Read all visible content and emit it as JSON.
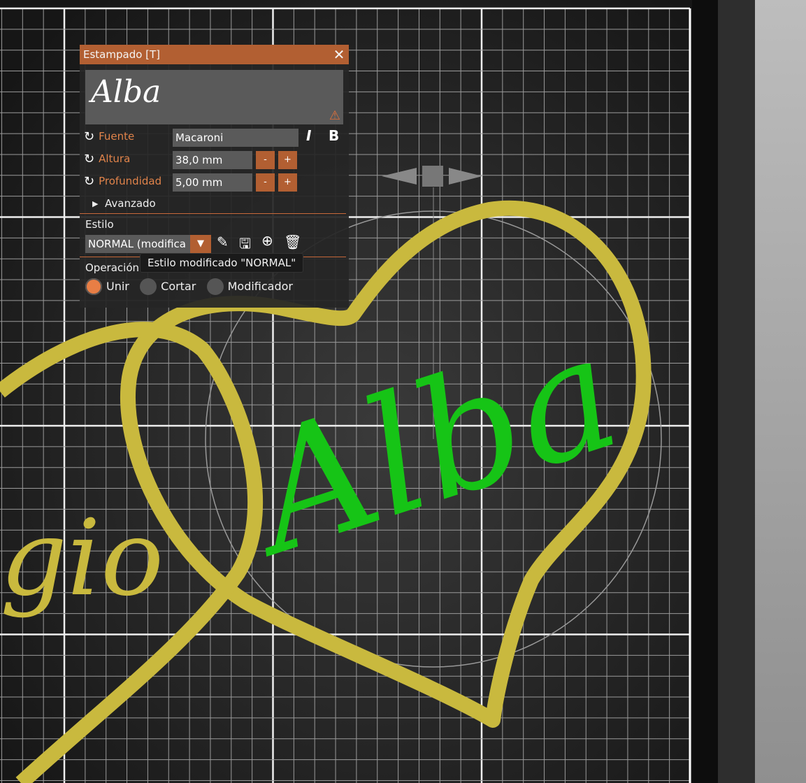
{
  "dialog": {
    "title": "Estampado [T]",
    "preview_text": "Alba",
    "font_label": "Fuente",
    "font_value": "Macaroni",
    "height_label": "Altura",
    "height_value": "38,0 mm",
    "depth_label": "Profundidad",
    "depth_value": "5,00 mm",
    "minus": "-",
    "plus": "+",
    "advanced_label": "Avanzado",
    "style_label": "Estilo",
    "style_value": "NORMAL (modifica",
    "style_tooltip": "Estilo modificado \"NORMAL\"",
    "operation_label": "Operación",
    "operations": [
      "Unir",
      "Cortar",
      "Modificador"
    ],
    "selected_operation": "Unir"
  },
  "scene": {
    "text_green": "Alba",
    "text_yellow": "gio"
  },
  "colors": {
    "accent": "#b25f32",
    "label": "#e0834a",
    "heart": "#c9b93e",
    "text3d": "#16c416"
  }
}
